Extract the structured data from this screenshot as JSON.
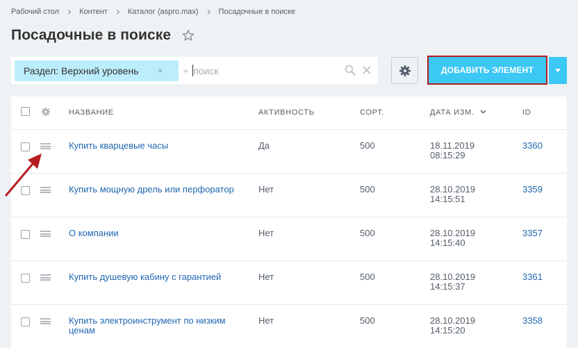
{
  "breadcrumb": [
    "Рабочий стол",
    "Контент",
    "Каталог (aspro.max)",
    "Посадочные в поиске"
  ],
  "page": {
    "title": "Посадочные в поиске",
    "favorite_icon": "star-icon"
  },
  "filter": {
    "chip_label": "Раздел: Верхний уровень",
    "chip_remove": "×",
    "add_symbol": "+",
    "search_placeholder": "поиск"
  },
  "toolbar": {
    "settings_icon": "gear-icon",
    "add_label": "ДОБАВИТЬ ЭЛЕМЕНТ"
  },
  "colors": {
    "accent": "#3bc8f5",
    "link": "#2067b0",
    "highlight": "#b31c20",
    "chip": "#bcedfc"
  },
  "table": {
    "columns": {
      "name": "НАЗВАНИЕ",
      "active": "АКТИВНОСТЬ",
      "sort": "СОРТ.",
      "date": "ДАТА ИЗМ.",
      "id": "ID"
    },
    "rows": [
      {
        "name": "Купить кварцевые часы",
        "active": "Да",
        "sort": "500",
        "date": "18.11.2019",
        "time": "08:15:29",
        "id": "3360"
      },
      {
        "name": "Купить мощную дрель или перфоратор",
        "active": "Нет",
        "sort": "500",
        "date": "28.10.2019",
        "time": "14:15:51",
        "id": "3359"
      },
      {
        "name": "О компании",
        "active": "Нет",
        "sort": "500",
        "date": "28.10.2019",
        "time": "14:15:40",
        "id": "3357"
      },
      {
        "name": "Купить душевую кабину с гарантией",
        "active": "Нет",
        "sort": "500",
        "date": "28.10.2019",
        "time": "14:15:37",
        "id": "3361"
      },
      {
        "name": "Купить электроинструмент по низким ценам",
        "active": "Нет",
        "sort": "500",
        "date": "28.10.2019",
        "time": "14:15:20",
        "id": "3358"
      }
    ]
  }
}
